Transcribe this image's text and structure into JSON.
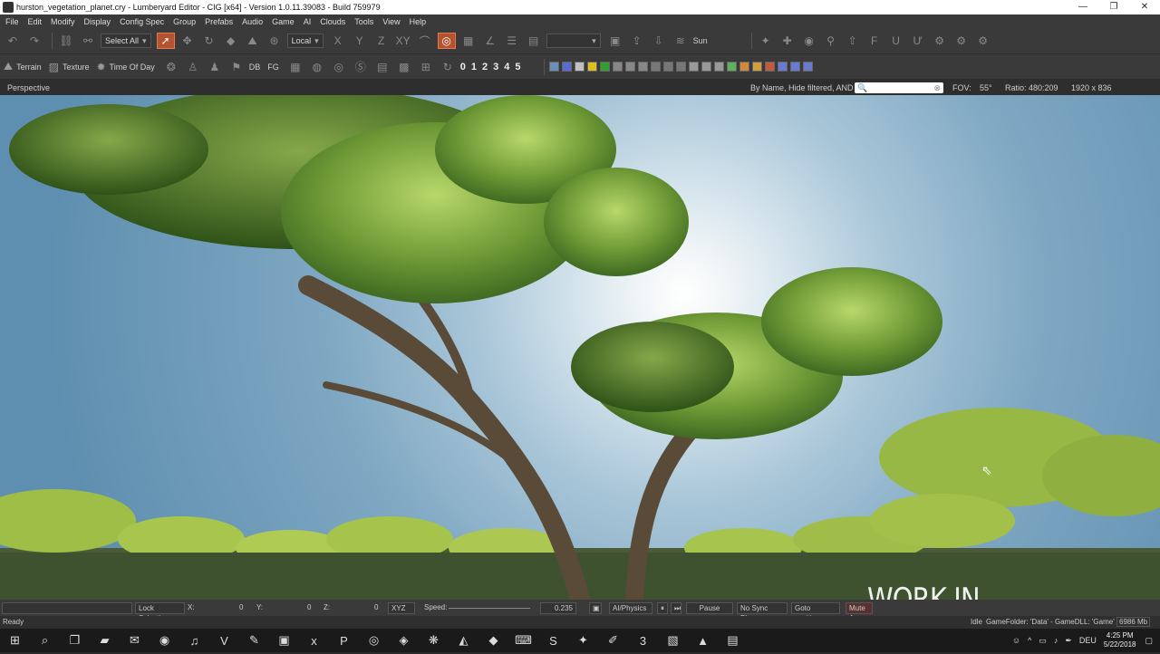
{
  "window": {
    "title": "hurston_vegetation_planet.cry - Lumberyard Editor - CIG [x64] - Version 1.0.11.39083 - Build 759979",
    "controls": [
      "—",
      "❐",
      "✕"
    ]
  },
  "menu": [
    "File",
    "Edit",
    "Modify",
    "Display",
    "Config Spec",
    "Group",
    "Prefabs",
    "Audio",
    "Game",
    "AI",
    "Clouds",
    "Tools",
    "View",
    "Help"
  ],
  "toolbar1": {
    "select_all": "Select All",
    "coord_system": "Local",
    "axis_x": "X",
    "axis_y": "Y",
    "axis_z": "Z",
    "axis_xy": "XY",
    "sun_label": "Sun"
  },
  "toolbar2": {
    "terrain": "Terrain",
    "texture": "Texture",
    "time_of_day": "Time Of Day",
    "db": "DB",
    "fg": "FG",
    "numbers": [
      "0",
      "1",
      "2",
      "3",
      "4",
      "5"
    ]
  },
  "viewport_header": {
    "view_name": "Perspective",
    "filter_text": "By Name, Hide filtered, AND",
    "search_value": "",
    "fov_label": "FOV:",
    "fov_value": "55°",
    "ratio_label": "Ratio: 480:209",
    "resolution": "1920 x 836"
  },
  "overlay": {
    "watermark": "WORK IN PROGRESS"
  },
  "statusbar": {
    "lock_selection": "Lock Selection",
    "x_label": "X:",
    "x_value": "0",
    "y_label": "Y:",
    "y_value": "0",
    "z_label": "Z:",
    "z_value": "0",
    "xyz": "XYZ",
    "speed_label": "Speed:",
    "speed_value": "0.235",
    "ai_physics": "AI/Physics",
    "pause": "Pause",
    "no_sync": "No Sync Player",
    "goto": "Goto position",
    "mute": "Mute A"
  },
  "bottom": {
    "ready": "Ready",
    "idle": "Idle",
    "game_folder": "GameFolder: 'Data' - GameDLL: 'Game'",
    "memory": "6986 Mb"
  },
  "taskbar": {
    "language": "DEU",
    "time": "4:25 PM",
    "date": "5/22/2018"
  }
}
